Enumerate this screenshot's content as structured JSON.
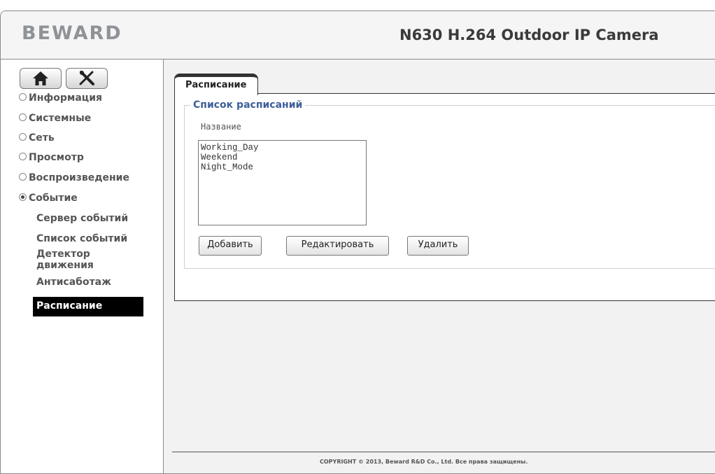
{
  "header": {
    "logo": "BEWARD",
    "model": "N630 H.264 Outdoor IP Camera"
  },
  "nav_buttons": [
    {
      "icon": "home-icon"
    },
    {
      "icon": "tools-icon"
    }
  ],
  "sidebar": {
    "items": [
      {
        "label": "Информация",
        "selected": false
      },
      {
        "label": "Системные",
        "selected": false
      },
      {
        "label": "Сеть",
        "selected": false
      },
      {
        "label": "Просмотр",
        "selected": false
      },
      {
        "label": "Воспроизведение",
        "selected": false
      },
      {
        "label": "Событие",
        "selected": true
      }
    ],
    "subitems": [
      {
        "label": "Сервер событий",
        "active": false
      },
      {
        "label": "Список событий",
        "active": false
      },
      {
        "label": "Детектор движения",
        "active": false
      },
      {
        "label": "Антисаботаж",
        "active": false
      },
      {
        "label": "Расписание",
        "active": true
      }
    ]
  },
  "tab": {
    "label": "Расписание"
  },
  "schedule": {
    "legend": "Список расписаний",
    "column_label": "Название",
    "list": [
      "Working_Day",
      "Weekend",
      "Night_Mode"
    ],
    "buttons": {
      "add": "Добавить",
      "edit": "Редактировать",
      "delete": "Удалить"
    }
  },
  "footer": {
    "copyright": "COPYRIGHT © 2013, Beward R&D Co., Ltd. Все права защищены."
  },
  "colors": {
    "legend": "#3d5f99",
    "active_item_bg": "#000000",
    "active_item_text": "#ffffff"
  }
}
